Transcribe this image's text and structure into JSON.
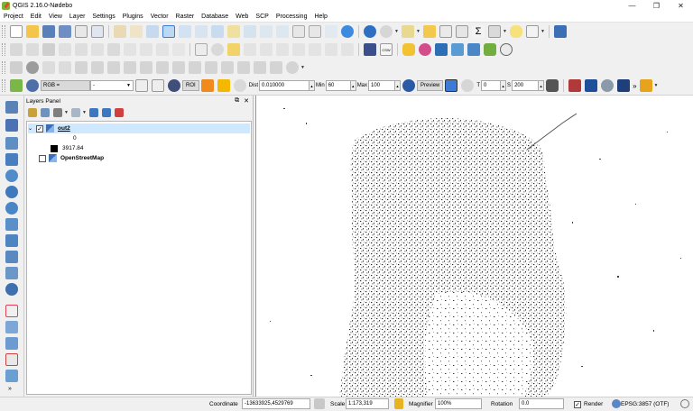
{
  "window": {
    "title": "QGIS 2.16.0-Nødebo",
    "controls": [
      "—",
      "❐",
      "✕"
    ]
  },
  "menu": [
    "Project",
    "Edit",
    "View",
    "Layer",
    "Settings",
    "Plugins",
    "Vector",
    "Raster",
    "Database",
    "Web",
    "SCP",
    "Processing",
    "Help"
  ],
  "scp_toolbar": {
    "rgb_label": "RGB =",
    "rgb_value": "-",
    "roi_label": "ROI",
    "dist_label": "Dist",
    "dist_value": "0.010000",
    "min_label": "Min",
    "min_value": "60",
    "max_label": "Max",
    "max_value": "100",
    "preview_label": "Preview",
    "t_label": "T",
    "t_value": "0",
    "s_label": "S",
    "s_value": "200",
    "overflow": "»"
  },
  "layers_panel": {
    "title": "Layers Panel",
    "layers": [
      {
        "name": "out2",
        "checked": true,
        "expanded": true,
        "legend": [
          {
            "label": "0",
            "color": "#ffffff"
          },
          {
            "label": "3917.84",
            "color": "#000000"
          }
        ]
      },
      {
        "name": "OpenStreetMap",
        "checked": false,
        "expanded": false
      }
    ]
  },
  "status": {
    "coordinate_label": "Coordinate",
    "coordinate_value": "-13633925,4529769",
    "scale_label": "Scale",
    "scale_value": "1:173,319",
    "magnifier_label": "Magnifier",
    "magnifier_value": "100%",
    "rotation_label": "Rotation",
    "rotation_value": "0.0",
    "render_label": "Render",
    "crs_label": "EPSG:3857 (OTF)"
  },
  "colors": {
    "accent": "#3b7dd8",
    "selection": "#cde8ff",
    "qgis_green": "#7fb23a"
  }
}
